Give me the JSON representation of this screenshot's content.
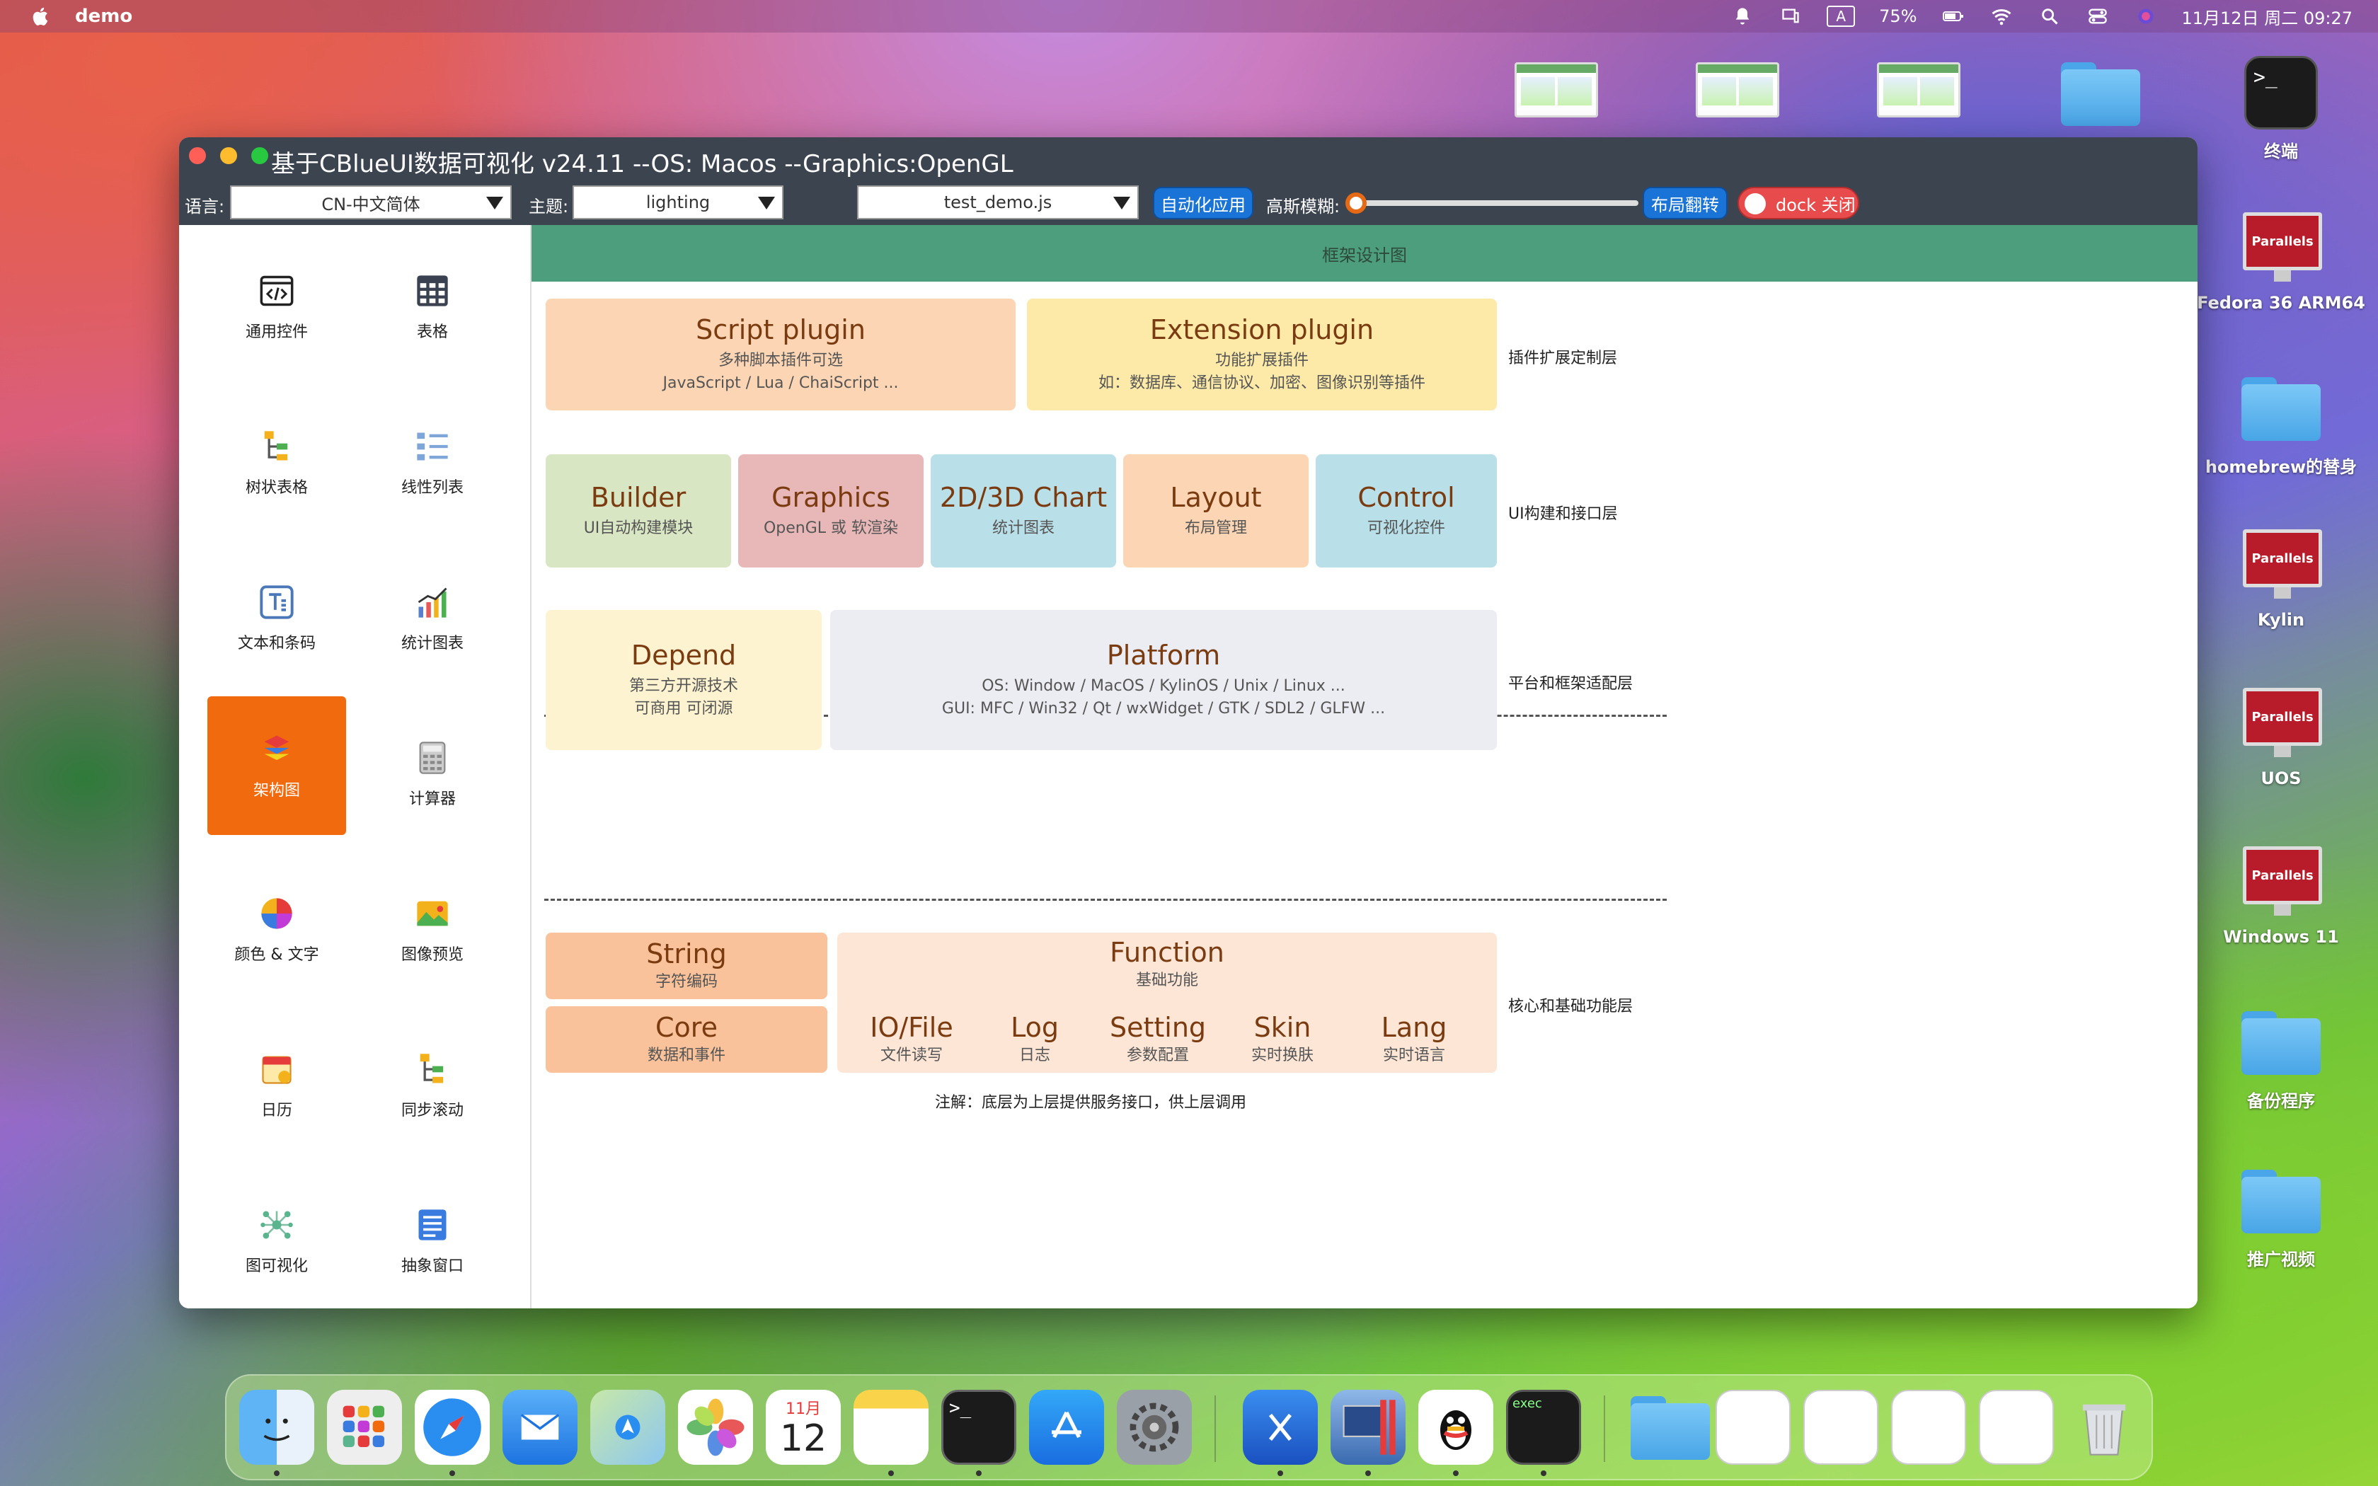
{
  "menubar": {
    "app_name": "demo",
    "apple_icon": "apple-icon",
    "battery": "75%",
    "input_method": "A",
    "datetime": "11月12日 周二 09:27",
    "icons": [
      "bell-icon",
      "screen-mirror-icon",
      "input-method-icon",
      "battery-icon",
      "wifi-icon",
      "search-icon",
      "control-center-icon",
      "siri-icon"
    ]
  },
  "desktop": {
    "icons": [
      {
        "label": "终端",
        "icon": "terminal-icon"
      },
      {
        "label": "Fedora 36 ARM64",
        "icon": "parallels-vm-icon"
      },
      {
        "label": "homebrew的替身",
        "icon": "folder-icon"
      },
      {
        "label": "Kylin",
        "icon": "parallels-vm-icon"
      },
      {
        "label": "UOS",
        "icon": "parallels-vm-icon"
      },
      {
        "label": "Windows 11",
        "icon": "parallels-vm-icon"
      },
      {
        "label": "备份程序",
        "icon": "folder-icon"
      },
      {
        "label": "推广视频",
        "icon": "folder-icon"
      }
    ],
    "parallels_badge": "Parallels",
    "terminal_prompt": ">_"
  },
  "window": {
    "title": "基于CBlueUI数据可视化  v24.11  --OS: Macos  --Graphics:OpenGL",
    "toolbar": {
      "language_label": "语言:",
      "language_value": "CN-中文简体",
      "theme_label": "主题:",
      "theme_value": "lighting",
      "script_value": "test_demo.js",
      "automation_button": "自动化应用",
      "blur_label": "高斯模糊:",
      "blur_value": 0,
      "layout_flip_button": "布局翻转",
      "dock_toggle": "dock 关闭"
    },
    "sidebar": {
      "items": [
        {
          "label": "通用控件",
          "icon": "code-window-icon"
        },
        {
          "label": "表格",
          "icon": "table-icon"
        },
        {
          "label": "树状表格",
          "icon": "tree-table-icon"
        },
        {
          "label": "线性列表",
          "icon": "list-icon"
        },
        {
          "label": "文本和条码",
          "icon": "text-icon"
        },
        {
          "label": "统计图表",
          "icon": "bar-chart-icon"
        },
        {
          "label": "架构图",
          "icon": "layers-icon",
          "active": true
        },
        {
          "label": "计算器",
          "icon": "calculator-icon"
        },
        {
          "label": "颜色 & 文字",
          "icon": "color-wheel-icon"
        },
        {
          "label": "图像预览",
          "icon": "image-icon"
        },
        {
          "label": "日历",
          "icon": "calendar-icon"
        },
        {
          "label": "同步滚动",
          "icon": "sync-scroll-icon"
        },
        {
          "label": "图可视化",
          "icon": "graph-icon"
        },
        {
          "label": "抽象窗口",
          "icon": "window-list-icon"
        }
      ]
    },
    "main": {
      "header": "框架设计图",
      "plugin_layer": {
        "label": "插件扩展定制层",
        "script": {
          "title": "Script plugin",
          "line1": "多种脚本插件可选",
          "line2": "JavaScript / Lua / ChaiScript ..."
        },
        "extension": {
          "title": "Extension plugin",
          "line1": "功能扩展插件",
          "line2": "如：数据库、通信协议、加密、图像识别等插件"
        }
      },
      "ui_layer": {
        "label": "UI构建和接口层",
        "builder": {
          "title": "Builder",
          "sub": "UI自动构建模块"
        },
        "graphics": {
          "title": "Graphics",
          "sub": "OpenGL 或 软渲染"
        },
        "chart": {
          "title": "2D/3D Chart",
          "sub": "统计图表"
        },
        "layout": {
          "title": "Layout",
          "sub": "布局管理"
        },
        "control": {
          "title": "Control",
          "sub": "可视化控件"
        }
      },
      "platform_layer": {
        "label": "平台和框架适配层",
        "depend": {
          "title": "Depend",
          "line1": "第三方开源技术",
          "line2": "可商用 可闭源"
        },
        "platform": {
          "title": "Platform",
          "line1": "OS: Window / MacOS / KylinOS / Unix / Linux ...",
          "line2": "GUI: MFC / Win32 / Qt / wxWidget / GTK / SDL2 / GLFW ..."
        }
      },
      "core_layer": {
        "label": "核心和基础功能层",
        "string": {
          "title": "String",
          "sub": "字符编码"
        },
        "core": {
          "title": "Core",
          "sub": "数据和事件"
        },
        "function": {
          "title": "Function",
          "sub": "基础功能"
        },
        "io": {
          "title": "IO/File",
          "sub": "文件读写"
        },
        "log": {
          "title": "Log",
          "sub": "日志"
        },
        "setting": {
          "title": "Setting",
          "sub": "参数配置"
        },
        "skin": {
          "title": "Skin",
          "sub": "实时换肤"
        },
        "lang": {
          "title": "Lang",
          "sub": "实时语言"
        }
      },
      "note": "注解：底层为上层提供服务接口，供上层调用"
    }
  },
  "dock": {
    "apps": [
      "finder-icon",
      "launchpad-icon",
      "safari-icon",
      "mail-icon",
      "maps-icon",
      "photos-icon",
      "calendar-icon",
      "notes-icon",
      "terminal-icon",
      "app-store-icon",
      "system-settings-icon",
      "xcode-icon",
      "parallels-icon",
      "qq-icon",
      "exec-icon",
      "downloads-folder-icon",
      "doc-thumb-icon",
      "doc-thumb-icon",
      "doc-thumb-icon",
      "doc-thumb-icon",
      "trash-icon"
    ],
    "calendar_month": "11月",
    "calendar_day": "12",
    "exec_label": "exec"
  },
  "colors": {
    "active_sidebar": "#f26a0e",
    "header_bg": "#4c9e7d",
    "titlebar": "#3c4450",
    "plugin_script": "#fcd6b4",
    "plugin_extension": "#fdeaa8",
    "builder": "#d9e6c4",
    "graphics": "#e8b8b8",
    "chart": "#b9dfe8",
    "layout": "#fcd6b4",
    "control": "#b9dfe8",
    "depend": "#fdf3d0",
    "platform": "#ececf3",
    "core_orange": "#f9c29a",
    "function_bg": "#fde6d6"
  }
}
